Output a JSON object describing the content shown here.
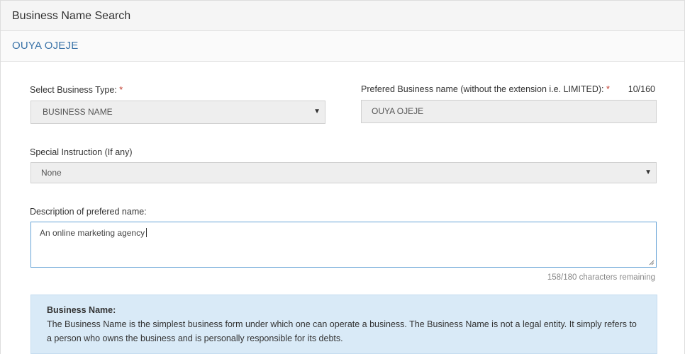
{
  "header": {
    "title": "Business Name Search"
  },
  "subheader": {
    "name": "OUYA OJEJE"
  },
  "form": {
    "business_type": {
      "label": "Select Business Type: ",
      "required_mark": "*",
      "value": "BUSINESS NAME"
    },
    "preferred_name": {
      "label": "Prefered Business name (without the extension i.e. LIMITED): ",
      "required_mark": "*",
      "counter": "10/160",
      "value": "OUYA OJEJE"
    },
    "special_instruction": {
      "label": "Special Instruction (If any)",
      "value": "None"
    },
    "description": {
      "label": "Description of prefered name:",
      "value": "An online marketing agency",
      "remaining": "158/180 characters remaining"
    }
  },
  "info_box": {
    "title": "Business Name:",
    "body": "The Business Name is the simplest business form under which one can operate a business. The Business Name is not a legal entity. It simply refers to a person who owns the business and is personally responsible for its debts."
  },
  "icons": {
    "dropdown": "caret-down-icon",
    "resize": "resize-grip-icon"
  },
  "colors": {
    "accent_blue": "#3a73a8",
    "focus_border": "#66a3d6",
    "info_bg": "#d9eaf7",
    "required": "#c0392b"
  }
}
